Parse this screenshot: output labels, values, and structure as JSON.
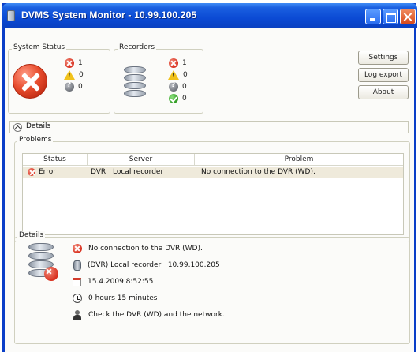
{
  "window": {
    "title": "DVMS System Monitor - 10.99.100.205"
  },
  "system_status": {
    "label": "System Status",
    "error_count": "1",
    "warning_count": "0",
    "unknown_count": "0"
  },
  "recorders": {
    "label": "Recorders",
    "error_count": "1",
    "warning_count": "0",
    "unknown_count": "0",
    "ok_count": "0"
  },
  "buttons": {
    "settings": "Settings",
    "log_export": "Log export",
    "about": "About"
  },
  "details_toggle": {
    "label": "Details"
  },
  "problems": {
    "label": "Problems",
    "columns": [
      "Status",
      "Server",
      "Problem"
    ],
    "rows": [
      {
        "status": "Error",
        "server_type": "DVR",
        "server_name": "Local recorder",
        "problem": "No connection to the DVR (WD)."
      }
    ]
  },
  "details": {
    "label": "Details",
    "message": "No connection to the DVR (WD).",
    "server": "(DVR) Local recorder   10.99.100.205",
    "timestamp": "15.4.2009 8:52:55",
    "duration": "0 hours 15 minutes",
    "advice": "Check the DVR (WD) and the network."
  },
  "colors": {
    "titlebar": "#0b4ad4",
    "error": "#d8301f",
    "warning": "#f1c21b",
    "ok": "#2f9a22",
    "selected_row": "#efeadb"
  }
}
